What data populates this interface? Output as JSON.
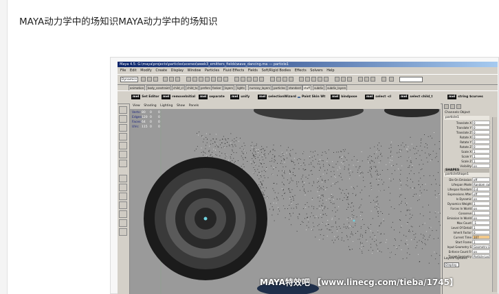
{
  "page": {
    "title": "MAYA动力学中的场知识MAYA动力学中的场知识"
  },
  "maya": {
    "window_title": "Maya 4.5: G:\\maya\\projects\\particles\\scenes\\week3_emitters_fields\\wave_dancing.ma  ---  particle1",
    "menus": [
      "File",
      "Edit",
      "Modify",
      "Create",
      "Display",
      "Window",
      "Particles",
      "Fluid Effects",
      "Fields",
      "Soft/Rigid Bodies",
      "Effects",
      "Solvers",
      "Help"
    ],
    "mode": "Dynamics",
    "shelf_tabs": [
      "animation",
      "body_constraint",
      "child_cl",
      "child_tx",
      "prefers",
      "fanker",
      "layers",
      "lights",
      "nurscay_layers",
      "particles",
      "standard",
      "stuff",
      "subdiv",
      "subdiv_layers"
    ],
    "active_shelf_tab": "stuff",
    "shelf_items": [
      {
        "icon": "mel",
        "label": "Set Editor"
      },
      {
        "icon": "mel",
        "label": "removeInitial"
      },
      {
        "icon": "mel",
        "label": "separate"
      },
      {
        "icon": "mel",
        "label": "unify"
      },
      {
        "icon": "mel",
        "label": "selectionWizard"
      },
      {
        "icon": "",
        "label": "Paint Skin Wt"
      },
      {
        "icon": "mel",
        "label": "bindpose"
      },
      {
        "icon": "mel",
        "label": "select -cl"
      },
      {
        "icon": "mel",
        "label": "select child_t"
      },
      {
        "icon": "mel",
        "label": "string $curves"
      }
    ],
    "panel_menus": [
      "View",
      "Shading",
      "Lighting",
      "Show",
      "Panels"
    ],
    "hud": [
      {
        "label": "Verts:",
        "a": "80",
        "b": "0",
        "c": "0"
      },
      {
        "label": "Edges:",
        "a": "120",
        "b": "0",
        "c": "0"
      },
      {
        "label": "Faces:",
        "a": "64",
        "b": "0",
        "c": "0"
      },
      {
        "label": "UVs:",
        "a": "115",
        "b": "0",
        "c": "0"
      }
    ],
    "channel_tabs": [
      "Channels",
      "Object"
    ],
    "node_name": "particle1",
    "transform_attrs": [
      {
        "name": "Translate X",
        "value": "0"
      },
      {
        "name": "Translate Y",
        "value": "0"
      },
      {
        "name": "Translate Z",
        "value": "0"
      },
      {
        "name": "Rotate X",
        "value": "0"
      },
      {
        "name": "Rotate Y",
        "value": "0"
      },
      {
        "name": "Rotate Z",
        "value": "0"
      },
      {
        "name": "Scale X",
        "value": "1"
      },
      {
        "name": "Scale Y",
        "value": "1"
      },
      {
        "name": "Scale Z",
        "value": "1"
      },
      {
        "name": "Visibility",
        "value": "on"
      }
    ],
    "shapes_label": "SHAPES",
    "shape_name": "particleShape1",
    "shape_attrs": [
      {
        "name": "Die On Emission",
        "value": "off"
      },
      {
        "name": "Lifespan Mode",
        "value": "Random ran"
      },
      {
        "name": "Lifespan Random",
        "value": "0.4"
      },
      {
        "name": "Expressions After",
        "value": "off"
      },
      {
        "name": "Is Dynamic",
        "value": "on"
      },
      {
        "name": "Dynamics Weight",
        "value": "1"
      },
      {
        "name": "Forces In World",
        "value": "on"
      },
      {
        "name": "Conserve",
        "value": "1"
      },
      {
        "name": "Emission In World",
        "value": "on"
      },
      {
        "name": "Max Count",
        "value": "-1"
      },
      {
        "name": "Level Of Detail",
        "value": "1"
      },
      {
        "name": "Inherit Factor",
        "value": "0"
      },
      {
        "name": "Current Time",
        "value": "107",
        "highlight": true
      },
      {
        "name": "Start Frame",
        "value": "1"
      },
      {
        "name": "Input Geometry S",
        "value": "Geometry Lo"
      },
      {
        "name": "Enforce Count Fr",
        "value": "on"
      },
      {
        "name": "Target Geometry",
        "value": "Particle Local"
      }
    ],
    "layer_tabs": [
      "Layers",
      "Options"
    ],
    "layer_mode": "Display",
    "watermark": "MAYA特效吧 【www.linecg.com/tieba/1745】"
  },
  "colors": {
    "maya_bg": "#d4d0c8",
    "viewport_bg": "#9a9a9a",
    "title_bar": "#0a246a",
    "highlight_field": "#f3c98b"
  }
}
